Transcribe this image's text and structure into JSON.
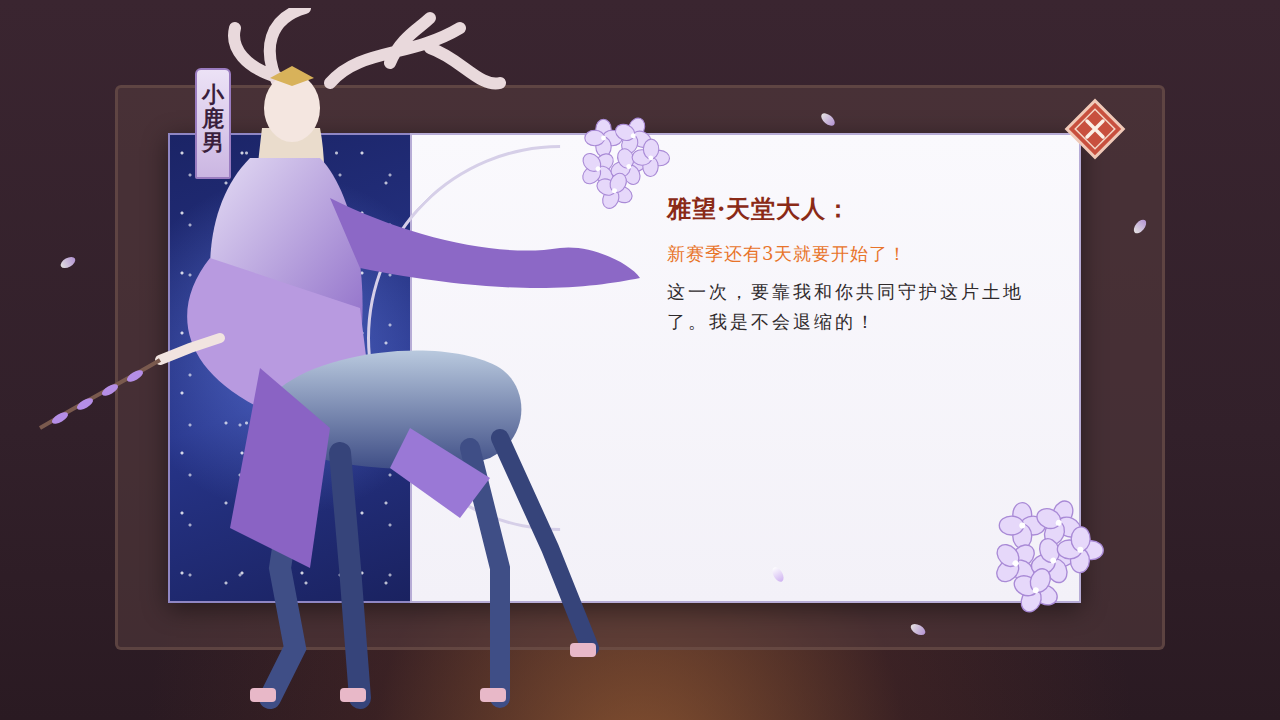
{
  "name_tab": {
    "label": "小鹿男"
  },
  "dialog": {
    "speaker": "雅望·天堂大人：",
    "highlight": "新赛季还有3天就要开始了！",
    "message": "这一次，要靠我和你共同守护这片土地了。我是不会退缩的！"
  }
}
